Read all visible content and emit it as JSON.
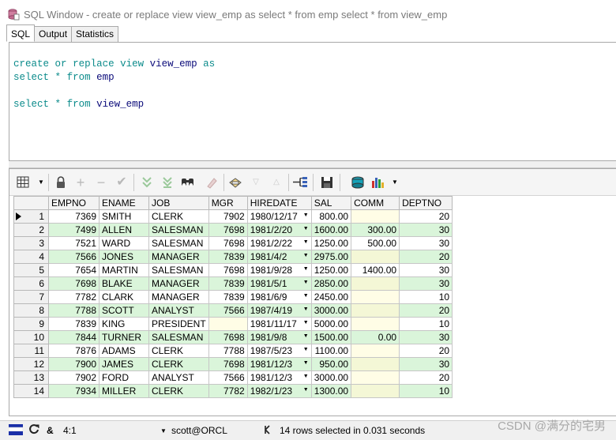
{
  "window": {
    "title": "SQL Window - create or replace view view_emp as select * from emp select * from view_emp"
  },
  "tabs": [
    {
      "label": "SQL",
      "active": true
    },
    {
      "label": "Output",
      "active": false
    },
    {
      "label": "Statistics",
      "active": false
    }
  ],
  "editor": {
    "lines": [
      [
        {
          "t": "create",
          "c": "kw"
        },
        {
          "t": " "
        },
        {
          "t": "or",
          "c": "kw"
        },
        {
          "t": " "
        },
        {
          "t": "replace",
          "c": "kw"
        },
        {
          "t": " "
        },
        {
          "t": "view",
          "c": "kw"
        },
        {
          "t": " "
        },
        {
          "t": "view_emp",
          "c": "id"
        },
        {
          "t": " "
        },
        {
          "t": "as",
          "c": "kw"
        }
      ],
      [
        {
          "t": "select",
          "c": "kw"
        },
        {
          "t": " "
        },
        {
          "t": "*",
          "c": "kw"
        },
        {
          "t": " "
        },
        {
          "t": "from",
          "c": "kw"
        },
        {
          "t": " "
        },
        {
          "t": "emp",
          "c": "id"
        }
      ],
      [],
      [
        {
          "t": "select",
          "c": "kw"
        },
        {
          "t": " "
        },
        {
          "t": "*",
          "c": "kw"
        },
        {
          "t": " "
        },
        {
          "t": "from",
          "c": "kw"
        },
        {
          "t": " "
        },
        {
          "t": "view_emp",
          "c": "id"
        }
      ]
    ]
  },
  "toolbar": {
    "icons": [
      "grid-icon",
      "lock-icon",
      "add-record-icon",
      "delete-record-icon",
      "post-icon",
      "fetch-next-icon",
      "fetch-last-icon",
      "find-icon",
      "clear-icon",
      "query-by-example-icon",
      "filter-icon",
      "sort-icon",
      "export-icon",
      "save-icon",
      "print-icon",
      "chart-icon"
    ]
  },
  "grid": {
    "columns": [
      "EMPNO",
      "ENAME",
      "JOB",
      "MGR",
      "HIREDATE",
      "SAL",
      "COMM",
      "DEPTNO"
    ],
    "rows": [
      [
        "7369",
        "SMITH",
        "CLERK",
        "7902",
        "1980/12/17",
        "800.00",
        "",
        "20"
      ],
      [
        "7499",
        "ALLEN",
        "SALESMAN",
        "7698",
        "1981/2/20",
        "1600.00",
        "300.00",
        "30"
      ],
      [
        "7521",
        "WARD",
        "SALESMAN",
        "7698",
        "1981/2/22",
        "1250.00",
        "500.00",
        "30"
      ],
      [
        "7566",
        "JONES",
        "MANAGER",
        "7839",
        "1981/4/2",
        "2975.00",
        "",
        "20"
      ],
      [
        "7654",
        "MARTIN",
        "SALESMAN",
        "7698",
        "1981/9/28",
        "1250.00",
        "1400.00",
        "30"
      ],
      [
        "7698",
        "BLAKE",
        "MANAGER",
        "7839",
        "1981/5/1",
        "2850.00",
        "",
        "30"
      ],
      [
        "7782",
        "CLARK",
        "MANAGER",
        "7839",
        "1981/6/9",
        "2450.00",
        "",
        "10"
      ],
      [
        "7788",
        "SCOTT",
        "ANALYST",
        "7566",
        "1987/4/19",
        "3000.00",
        "",
        "20"
      ],
      [
        "7839",
        "KING",
        "PRESIDENT",
        "",
        "1981/11/17",
        "5000.00",
        "",
        "10"
      ],
      [
        "7844",
        "TURNER",
        "SALESMAN",
        "7698",
        "1981/9/8",
        "1500.00",
        "0.00",
        "30"
      ],
      [
        "7876",
        "ADAMS",
        "CLERK",
        "7788",
        "1987/5/23",
        "1100.00",
        "",
        "20"
      ],
      [
        "7900",
        "JAMES",
        "CLERK",
        "7698",
        "1981/12/3",
        "950.00",
        "",
        "30"
      ],
      [
        "7902",
        "FORD",
        "ANALYST",
        "7566",
        "1981/12/3",
        "3000.00",
        "",
        "20"
      ],
      [
        "7934",
        "MILLER",
        "CLERK",
        "7782",
        "1982/1/23",
        "1300.00",
        "",
        "10"
      ]
    ]
  },
  "status": {
    "position": "4:1",
    "connection": "scott@ORCL",
    "message": "14 rows selected in 0.031 seconds"
  },
  "watermark": "CSDN @满分的宅男"
}
